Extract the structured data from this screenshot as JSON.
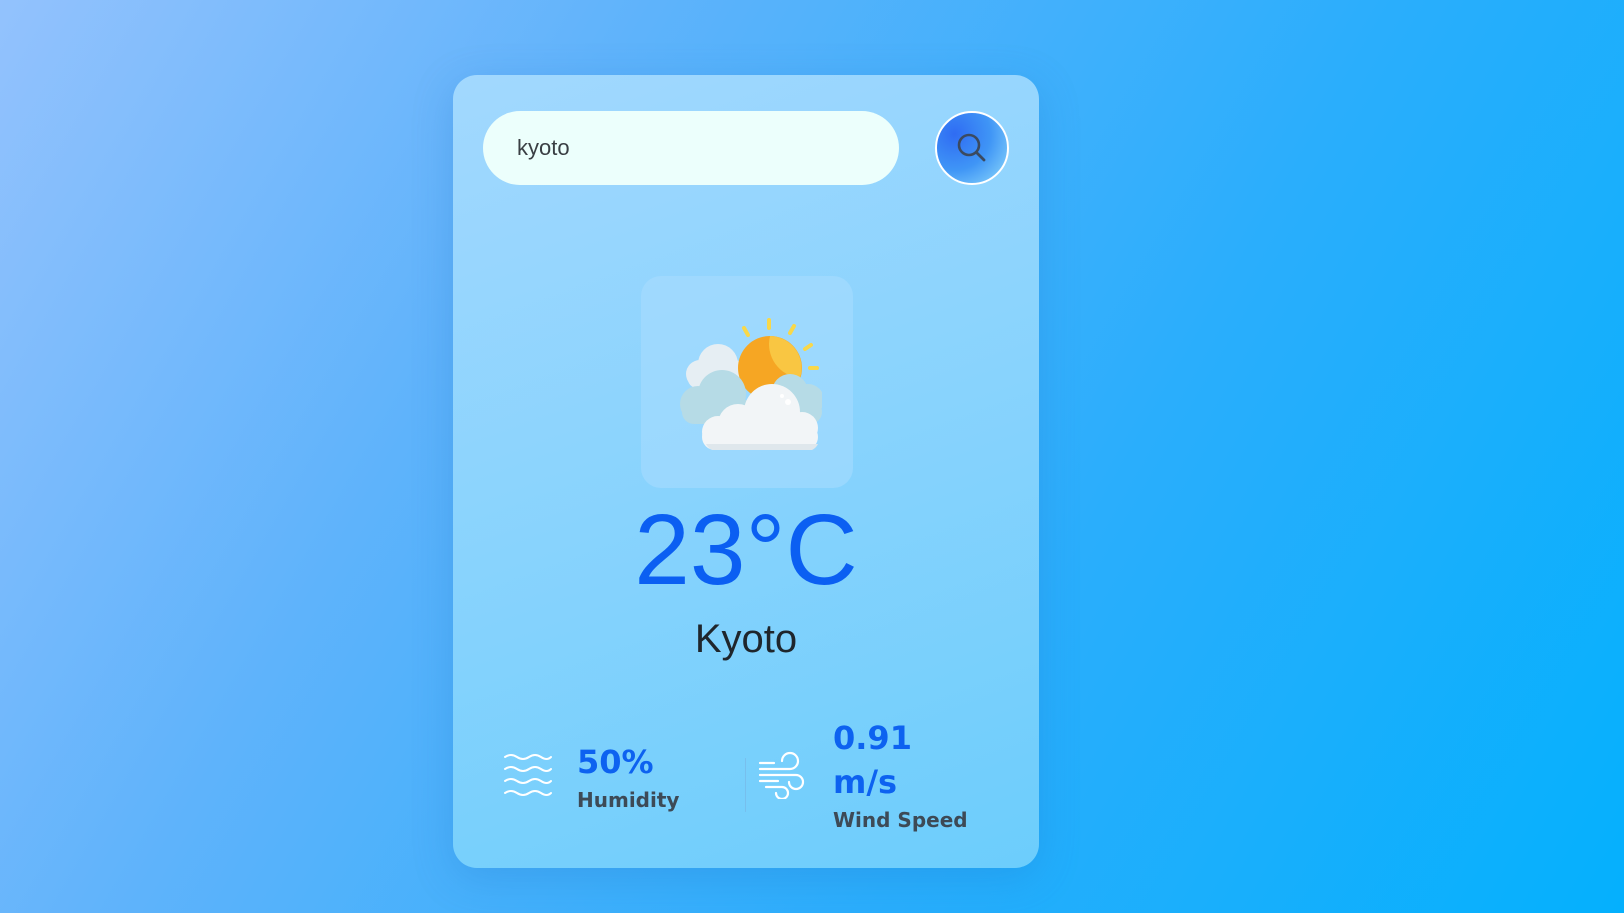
{
  "search": {
    "value": "kyoto",
    "button_icon": "search-icon"
  },
  "weather": {
    "icon": "partly-cloudy-sun-icon",
    "temperature": "23°C",
    "city": "Kyoto"
  },
  "stats": {
    "humidity": {
      "icon": "humidity-waves-icon",
      "value": "50%",
      "label": "Humidity"
    },
    "wind": {
      "icon": "wind-icon",
      "value": "0.91 m/s",
      "label": "Wind Speed"
    }
  },
  "colors": {
    "accent": "#0b5ff2",
    "card_background": "#88d3fd",
    "search_field_background": "#ecfffc"
  }
}
